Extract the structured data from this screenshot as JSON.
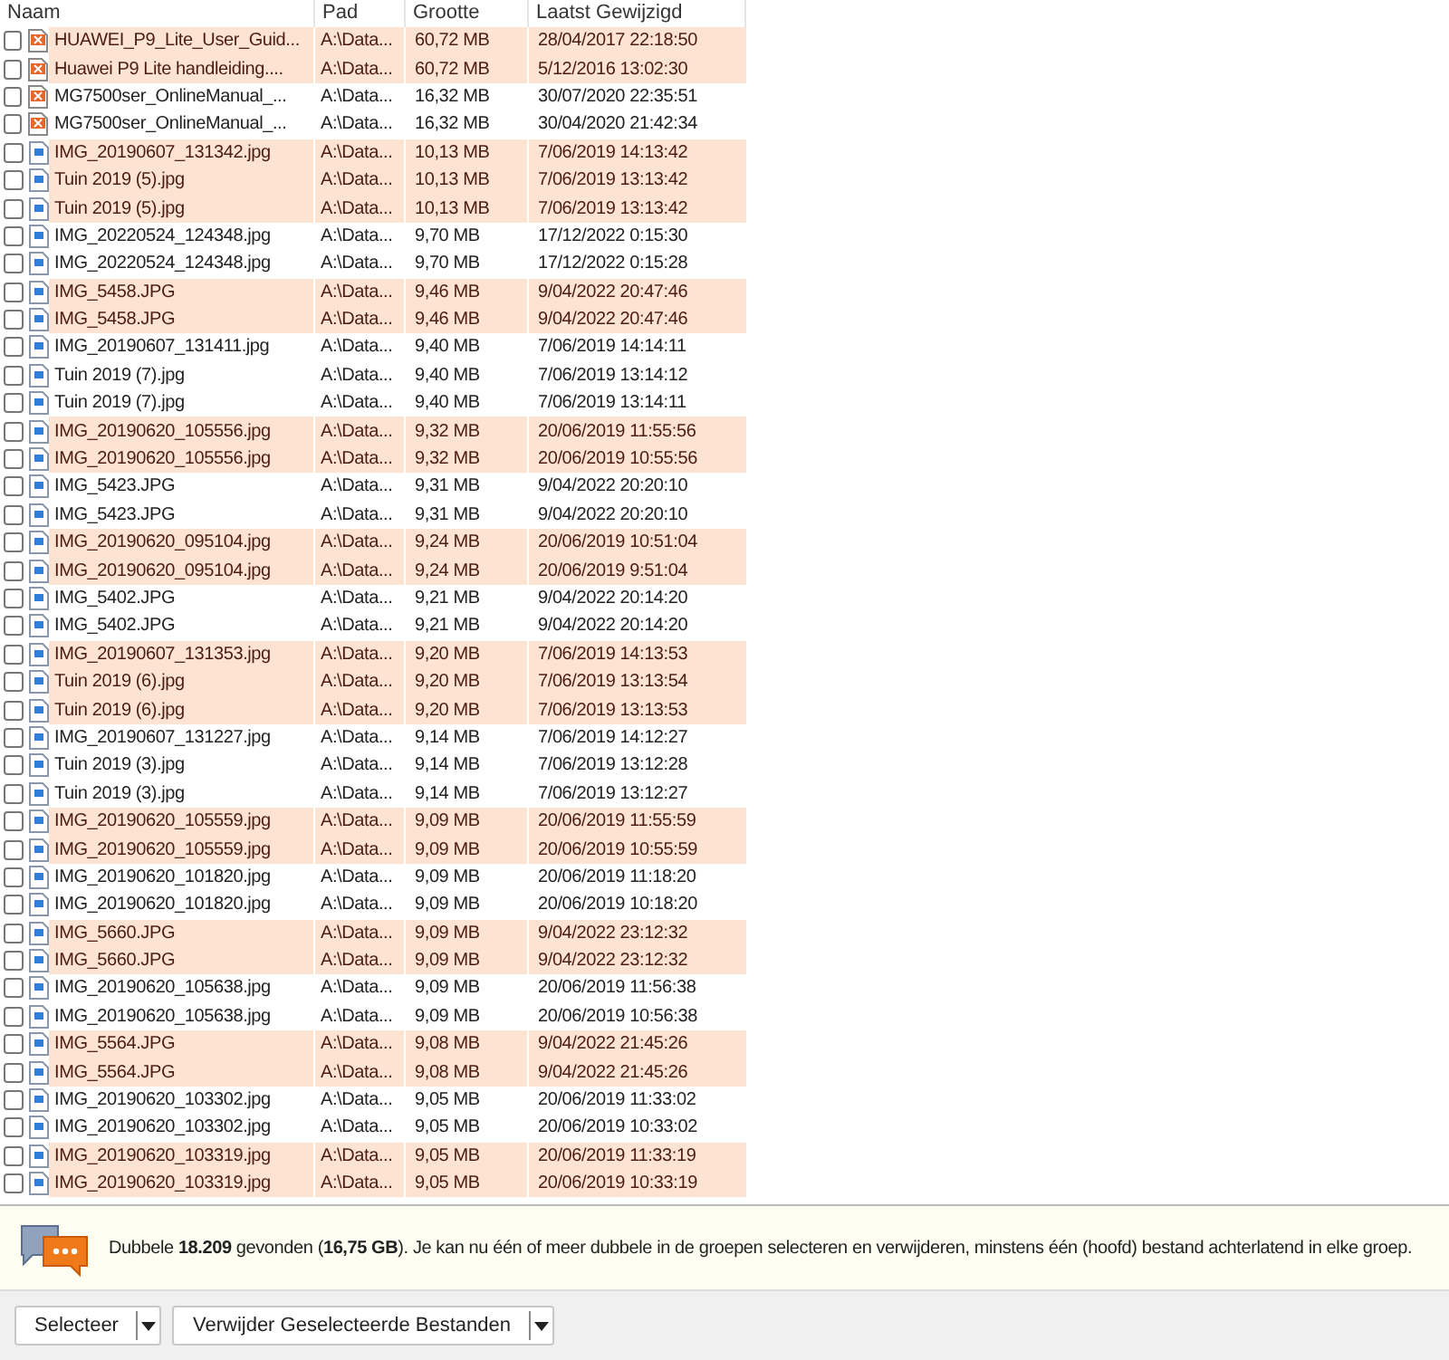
{
  "columns": [
    "Naam",
    "Pad",
    "Grootte",
    "Laatst Gewijzigd"
  ],
  "rows": [
    {
      "kind": "pdf",
      "name": "HUAWEI_P9_Lite_User_Guid...",
      "path": "A:\\Data...",
      "size": "60,72 MB",
      "modified": "28/04/2017 22:18:50",
      "shaded": true,
      "checked": false
    },
    {
      "kind": "pdf",
      "name": "Huawei P9 Lite handleiding....",
      "path": "A:\\Data...",
      "size": "60,72 MB",
      "modified": "5/12/2016 13:02:30",
      "shaded": true,
      "checked": false
    },
    {
      "kind": "pdf",
      "name": "MG7500ser_OnlineManual_...",
      "path": "A:\\Data...",
      "size": "16,32 MB",
      "modified": "30/07/2020 22:35:51",
      "shaded": false,
      "checked": false
    },
    {
      "kind": "pdf",
      "name": "MG7500ser_OnlineManual_...",
      "path": "A:\\Data...",
      "size": "16,32 MB",
      "modified": "30/04/2020 21:42:34",
      "shaded": false,
      "checked": false
    },
    {
      "kind": "image",
      "name": "IMG_20190607_131342.jpg",
      "path": "A:\\Data...",
      "size": "10,13 MB",
      "modified": "7/06/2019 14:13:42",
      "shaded": true,
      "checked": false
    },
    {
      "kind": "image",
      "name": "Tuin 2019 (5).jpg",
      "path": "A:\\Data...",
      "size": "10,13 MB",
      "modified": "7/06/2019 13:13:42",
      "shaded": true,
      "checked": false
    },
    {
      "kind": "image",
      "name": "Tuin 2019 (5).jpg",
      "path": "A:\\Data...",
      "size": "10,13 MB",
      "modified": "7/06/2019 13:13:42",
      "shaded": true,
      "checked": false
    },
    {
      "kind": "image",
      "name": "IMG_20220524_124348.jpg",
      "path": "A:\\Data...",
      "size": "9,70 MB",
      "modified": "17/12/2022 0:15:30",
      "shaded": false,
      "checked": false
    },
    {
      "kind": "image",
      "name": "IMG_20220524_124348.jpg",
      "path": "A:\\Data...",
      "size": "9,70 MB",
      "modified": "17/12/2022 0:15:28",
      "shaded": false,
      "checked": false
    },
    {
      "kind": "image",
      "name": "IMG_5458.JPG",
      "path": "A:\\Data...",
      "size": "9,46 MB",
      "modified": "9/04/2022 20:47:46",
      "shaded": true,
      "checked": false
    },
    {
      "kind": "image",
      "name": "IMG_5458.JPG",
      "path": "A:\\Data...",
      "size": "9,46 MB",
      "modified": "9/04/2022 20:47:46",
      "shaded": true,
      "checked": false
    },
    {
      "kind": "image",
      "name": "IMG_20190607_131411.jpg",
      "path": "A:\\Data...",
      "size": "9,40 MB",
      "modified": "7/06/2019 14:14:11",
      "shaded": false,
      "checked": false
    },
    {
      "kind": "image",
      "name": "Tuin 2019 (7).jpg",
      "path": "A:\\Data...",
      "size": "9,40 MB",
      "modified": "7/06/2019 13:14:12",
      "shaded": false,
      "checked": false
    },
    {
      "kind": "image",
      "name": "Tuin 2019 (7).jpg",
      "path": "A:\\Data...",
      "size": "9,40 MB",
      "modified": "7/06/2019 13:14:11",
      "shaded": false,
      "checked": false
    },
    {
      "kind": "image",
      "name": "IMG_20190620_105556.jpg",
      "path": "A:\\Data...",
      "size": "9,32 MB",
      "modified": "20/06/2019 11:55:56",
      "shaded": true,
      "checked": false
    },
    {
      "kind": "image",
      "name": "IMG_20190620_105556.jpg",
      "path": "A:\\Data...",
      "size": "9,32 MB",
      "modified": "20/06/2019 10:55:56",
      "shaded": true,
      "checked": false
    },
    {
      "kind": "image",
      "name": "IMG_5423.JPG",
      "path": "A:\\Data...",
      "size": "9,31 MB",
      "modified": "9/04/2022 20:20:10",
      "shaded": false,
      "checked": false
    },
    {
      "kind": "image",
      "name": "IMG_5423.JPG",
      "path": "A:\\Data...",
      "size": "9,31 MB",
      "modified": "9/04/2022 20:20:10",
      "shaded": false,
      "checked": false
    },
    {
      "kind": "image",
      "name": "IMG_20190620_095104.jpg",
      "path": "A:\\Data...",
      "size": "9,24 MB",
      "modified": "20/06/2019 10:51:04",
      "shaded": true,
      "checked": false
    },
    {
      "kind": "image",
      "name": "IMG_20190620_095104.jpg",
      "path": "A:\\Data...",
      "size": "9,24 MB",
      "modified": "20/06/2019 9:51:04",
      "shaded": true,
      "checked": false
    },
    {
      "kind": "image",
      "name": "IMG_5402.JPG",
      "path": "A:\\Data...",
      "size": "9,21 MB",
      "modified": "9/04/2022 20:14:20",
      "shaded": false,
      "checked": false
    },
    {
      "kind": "image",
      "name": "IMG_5402.JPG",
      "path": "A:\\Data...",
      "size": "9,21 MB",
      "modified": "9/04/2022 20:14:20",
      "shaded": false,
      "checked": false
    },
    {
      "kind": "image",
      "name": "IMG_20190607_131353.jpg",
      "path": "A:\\Data...",
      "size": "9,20 MB",
      "modified": "7/06/2019 14:13:53",
      "shaded": true,
      "checked": false
    },
    {
      "kind": "image",
      "name": "Tuin 2019 (6).jpg",
      "path": "A:\\Data...",
      "size": "9,20 MB",
      "modified": "7/06/2019 13:13:54",
      "shaded": true,
      "checked": false
    },
    {
      "kind": "image",
      "name": "Tuin 2019 (6).jpg",
      "path": "A:\\Data...",
      "size": "9,20 MB",
      "modified": "7/06/2019 13:13:53",
      "shaded": true,
      "checked": false
    },
    {
      "kind": "image",
      "name": "IMG_20190607_131227.jpg",
      "path": "A:\\Data...",
      "size": "9,14 MB",
      "modified": "7/06/2019 14:12:27",
      "shaded": false,
      "checked": false
    },
    {
      "kind": "image",
      "name": "Tuin 2019 (3).jpg",
      "path": "A:\\Data...",
      "size": "9,14 MB",
      "modified": "7/06/2019 13:12:28",
      "shaded": false,
      "checked": false
    },
    {
      "kind": "image",
      "name": "Tuin 2019 (3).jpg",
      "path": "A:\\Data...",
      "size": "9,14 MB",
      "modified": "7/06/2019 13:12:27",
      "shaded": false,
      "checked": false
    },
    {
      "kind": "image",
      "name": "IMG_20190620_105559.jpg",
      "path": "A:\\Data...",
      "size": "9,09 MB",
      "modified": "20/06/2019 11:55:59",
      "shaded": true,
      "checked": false
    },
    {
      "kind": "image",
      "name": "IMG_20190620_105559.jpg",
      "path": "A:\\Data...",
      "size": "9,09 MB",
      "modified": "20/06/2019 10:55:59",
      "shaded": true,
      "checked": false
    },
    {
      "kind": "image",
      "name": "IMG_20190620_101820.jpg",
      "path": "A:\\Data...",
      "size": "9,09 MB",
      "modified": "20/06/2019 11:18:20",
      "shaded": false,
      "checked": false
    },
    {
      "kind": "image",
      "name": "IMG_20190620_101820.jpg",
      "path": "A:\\Data...",
      "size": "9,09 MB",
      "modified": "20/06/2019 10:18:20",
      "shaded": false,
      "checked": false
    },
    {
      "kind": "image",
      "name": "IMG_5660.JPG",
      "path": "A:\\Data...",
      "size": "9,09 MB",
      "modified": "9/04/2022 23:12:32",
      "shaded": true,
      "checked": false
    },
    {
      "kind": "image",
      "name": "IMG_5660.JPG",
      "path": "A:\\Data...",
      "size": "9,09 MB",
      "modified": "9/04/2022 23:12:32",
      "shaded": true,
      "checked": false
    },
    {
      "kind": "image",
      "name": "IMG_20190620_105638.jpg",
      "path": "A:\\Data...",
      "size": "9,09 MB",
      "modified": "20/06/2019 11:56:38",
      "shaded": false,
      "checked": false
    },
    {
      "kind": "image",
      "name": "IMG_20190620_105638.jpg",
      "path": "A:\\Data...",
      "size": "9,09 MB",
      "modified": "20/06/2019 10:56:38",
      "shaded": false,
      "checked": false
    },
    {
      "kind": "image",
      "name": "IMG_5564.JPG",
      "path": "A:\\Data...",
      "size": "9,08 MB",
      "modified": "9/04/2022 21:45:26",
      "shaded": true,
      "checked": false
    },
    {
      "kind": "image",
      "name": "IMG_5564.JPG",
      "path": "A:\\Data...",
      "size": "9,08 MB",
      "modified": "9/04/2022 21:45:26",
      "shaded": true,
      "checked": false
    },
    {
      "kind": "image",
      "name": "IMG_20190620_103302.jpg",
      "path": "A:\\Data...",
      "size": "9,05 MB",
      "modified": "20/06/2019 11:33:02",
      "shaded": false,
      "checked": false
    },
    {
      "kind": "image",
      "name": "IMG_20190620_103302.jpg",
      "path": "A:\\Data...",
      "size": "9,05 MB",
      "modified": "20/06/2019 10:33:02",
      "shaded": false,
      "checked": false
    },
    {
      "kind": "image",
      "name": "IMG_20190620_103319.jpg",
      "path": "A:\\Data...",
      "size": "9,05 MB",
      "modified": "20/06/2019 11:33:19",
      "shaded": true,
      "checked": false
    },
    {
      "kind": "image",
      "name": "IMG_20190620_103319.jpg",
      "path": "A:\\Data...",
      "size": "9,05 MB",
      "modified": "20/06/2019 10:33:19",
      "shaded": true,
      "checked": false
    }
  ],
  "info_message": "Dubbele **18.209** gevonden (**16,75 GB**). Je kan nu één of meer dubbele in de groepen selecteren en verwijderen, minstens één (hoofd) bestand achterlatend in elke groep.",
  "buttons": [
    "Selecteer",
    "Verwijder Geselecteerde Bestanden"
  ]
}
